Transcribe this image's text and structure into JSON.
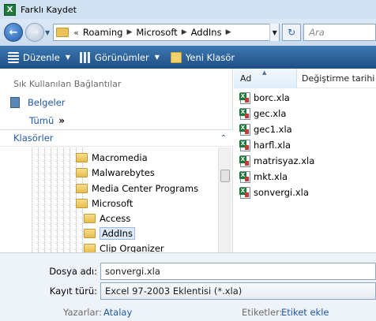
{
  "window": {
    "title": "Farklı Kaydet",
    "app_icon": "excel-icon"
  },
  "address": {
    "overflow": "«",
    "crumbs": [
      "Roaming",
      "Microsoft",
      "AddIns"
    ],
    "search_placeholder": "Ara"
  },
  "toolbar": {
    "organize": "Düzenle",
    "views": "Görünümler",
    "new_folder": "Yeni Klasör"
  },
  "favorites": {
    "header": "Sık Kullanılan Bağlantılar",
    "items": [
      "Belgeler"
    ],
    "more": "Tümü",
    "more_chevron": "»"
  },
  "folders": {
    "label": "Klasörler",
    "tree": [
      {
        "label": "Macromedia"
      },
      {
        "label": "Malwarebytes"
      },
      {
        "label": "Media Center Programs"
      },
      {
        "label": "Microsoft"
      },
      {
        "label": "Access"
      },
      {
        "label": "AddIns"
      },
      {
        "label": "Clip Organizer"
      }
    ]
  },
  "list": {
    "columns": [
      "Ad",
      "Değiştirme tarihi"
    ],
    "files": [
      "borc.xla",
      "gec.xla",
      "gec1.xla",
      "harfl.xla",
      "matrisyaz.xla",
      "mkt.xla",
      "sonvergi.xla"
    ]
  },
  "form": {
    "filename_label": "Dosya adı:",
    "filename_value": "sonvergi.xla",
    "type_label": "Kayıt türü:",
    "type_value": "Excel 97-2003 Eklentisi (*.xla)",
    "authors_label": "Yazarlar:",
    "authors_value": "Atalay",
    "tags_label": "Etiketler:",
    "tags_value": "Etiket ekle"
  }
}
